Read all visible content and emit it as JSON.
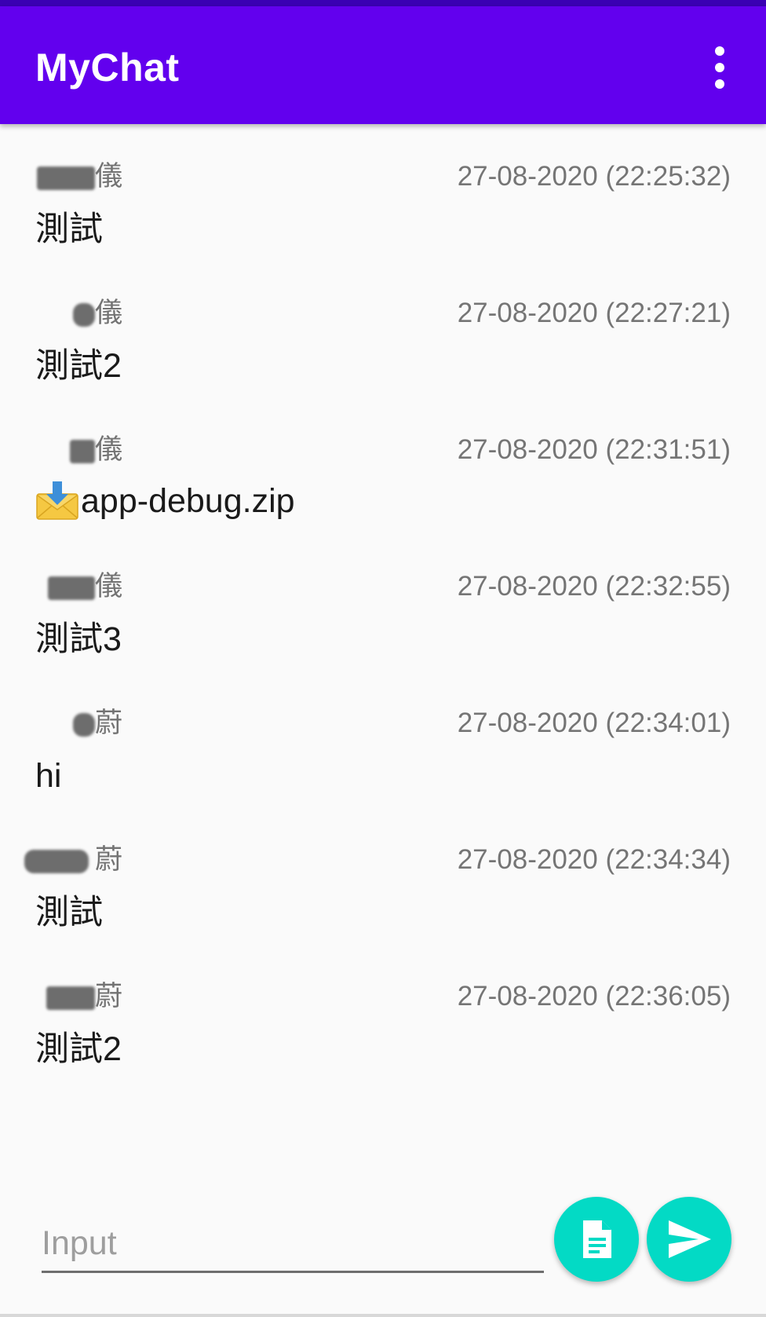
{
  "app_bar": {
    "title": "MyChat",
    "background_color": "#6200ee",
    "overflow_icon": "more-vert-icon"
  },
  "messages": [
    {
      "sender": "儀",
      "timestamp": "27-08-2020 (22:25:32)",
      "text": "測試"
    },
    {
      "sender": "儀",
      "timestamp": "27-08-2020 (22:27:21)",
      "text": "測試2"
    },
    {
      "sender": "儀",
      "timestamp": "27-08-2020 (22:31:51)",
      "file_name": "app-debug.zip",
      "file_icon": "incoming-envelope-icon"
    },
    {
      "sender": "儀",
      "timestamp": "27-08-2020 (22:32:55)",
      "text": "測試3"
    },
    {
      "sender": "蔚",
      "timestamp": "27-08-2020 (22:34:01)",
      "text": "hi"
    },
    {
      "sender": "蔚",
      "timestamp": "27-08-2020 (22:34:34)",
      "text": "測試"
    },
    {
      "sender": "蔚",
      "timestamp": "27-08-2020 (22:36:05)",
      "text": "測試2"
    }
  ],
  "composer": {
    "input_placeholder": "Input",
    "input_value": "",
    "attach_icon": "document-icon",
    "send_icon": "send-icon",
    "fab_color": "#03dac5"
  }
}
